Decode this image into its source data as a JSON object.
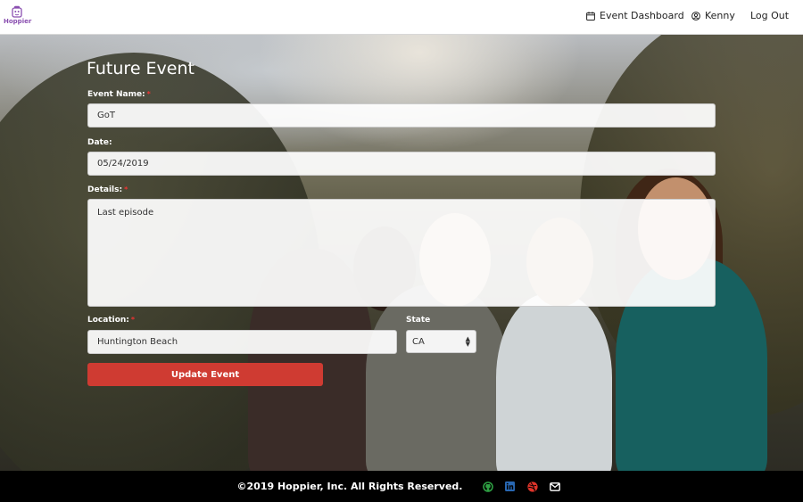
{
  "navbar": {
    "brand": "Hoppier",
    "dashboard_label": "Event Dashboard",
    "user_label": "Kenny",
    "logout_label": "Log Out"
  },
  "form": {
    "title": "Future Event",
    "event_name": {
      "label": "Event Name:",
      "value": "GoT",
      "required": "*"
    },
    "date": {
      "label": "Date:",
      "value": "05/24/2019"
    },
    "details": {
      "label": "Details:",
      "value": "Last episode",
      "required": "*"
    },
    "location": {
      "label": "Location:",
      "value": "Huntington Beach",
      "required": "*"
    },
    "state": {
      "label": "State",
      "value": "CA"
    },
    "submit_label": "Update Event"
  },
  "footer": {
    "copyright": "©2019 Hoppier, Inc. All Rights Reserved.",
    "icons": [
      "github-icon",
      "linkedin-icon",
      "dribbble-icon",
      "mail-icon"
    ]
  },
  "colors": {
    "accent": "#cf3b32",
    "brand": "#8a4fb0",
    "github": "#2ea043",
    "linkedin": "#2867b2",
    "dribbble": "#e0342a"
  }
}
